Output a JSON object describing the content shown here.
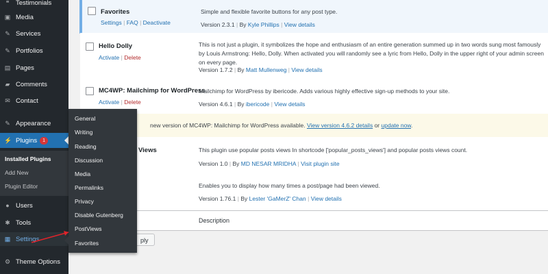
{
  "sidebar": {
    "items": [
      {
        "label": "Testimonials",
        "icon": "testimonials-icon"
      },
      {
        "label": "Media",
        "icon": "media-icon"
      },
      {
        "label": "Services",
        "icon": "pin-icon"
      },
      {
        "label": "Portfolios",
        "icon": "pin-icon"
      },
      {
        "label": "Pages",
        "icon": "pages-icon"
      },
      {
        "label": "Comments",
        "icon": "comments-icon"
      },
      {
        "label": "Contact",
        "icon": "mail-icon"
      },
      {
        "label": "Appearance",
        "icon": "appearance-icon"
      },
      {
        "label": "Plugins",
        "icon": "plugins-icon",
        "badge": "1"
      },
      {
        "label": "Users",
        "icon": "users-icon"
      },
      {
        "label": "Tools",
        "icon": "tools-icon"
      },
      {
        "label": "Settings",
        "icon": "settings-icon"
      },
      {
        "label": "Theme Options",
        "icon": "gear-icon"
      }
    ],
    "plugins_submenu": [
      "Installed Plugins",
      "Add New",
      "Plugin Editor"
    ]
  },
  "settings_flyout": [
    "General",
    "Writing",
    "Reading",
    "Discussion",
    "Media",
    "Permalinks",
    "Privacy",
    "Disable Gutenberg",
    "PostViews",
    "Favorites"
  ],
  "plugins": [
    {
      "name": "Favorites",
      "actions": [
        "Settings",
        "FAQ",
        "Deactivate"
      ],
      "description": "Simple and flexible favorite buttons for any post type.",
      "version": "Version 2.3.1",
      "by": "By",
      "author": "Kyle Phillips",
      "details": "View details"
    },
    {
      "name": "Hello Dolly",
      "actions": [
        "Activate",
        "Delete"
      ],
      "description": "This is not just a plugin, it symbolizes the hope and enthusiasm of an entire generation summed up in two words sung most famously by Louis Armstrong: Hello, Dolly. When activated you will randomly see a lyric from Hello, Dolly in the upper right of your admin screen on every page.",
      "version": "Version 1.7.2",
      "by": "By",
      "author": "Matt Mullenweg",
      "details": "View details"
    },
    {
      "name": "MC4WP: Mailchimp for WordPress",
      "actions": [
        "Activate",
        "Delete"
      ],
      "description": "Mailchimp for WordPress by ibericode. Adds various highly effective sign-up methods to your site.",
      "version": "Version 4.6.1",
      "by": "By",
      "author": "ibericode",
      "details": "View details"
    },
    {
      "name": "Views",
      "description": "This plugin use popular posts views In shortcode ['popular_posts_views'] and popular posts views count.",
      "version": "Version 1.0",
      "by": "By",
      "author": "MD NESAR MRIDHA",
      "details": "Visit plugin site"
    },
    {
      "description": "Enables you to display how many times a post/page had been viewed.",
      "version": "Version 1.76.1",
      "by": "By",
      "author": "Lester 'GaMerZ' Chan",
      "details": "View details"
    }
  ],
  "update_notice": {
    "text": "new version of MC4WP: Mailchimp for WordPress available.",
    "link1": "View version 4.6.2 details",
    "or": "or",
    "link2": "update now",
    "end": "."
  },
  "footer": {
    "description_header": "Description",
    "apply_label": "ply"
  },
  "colors": {
    "sidebar_bg": "#23282d",
    "active_blue": "#2271b1",
    "link": "#2271b1",
    "delete": "#b32d2e",
    "annotation_arrow": "#e0232a"
  }
}
